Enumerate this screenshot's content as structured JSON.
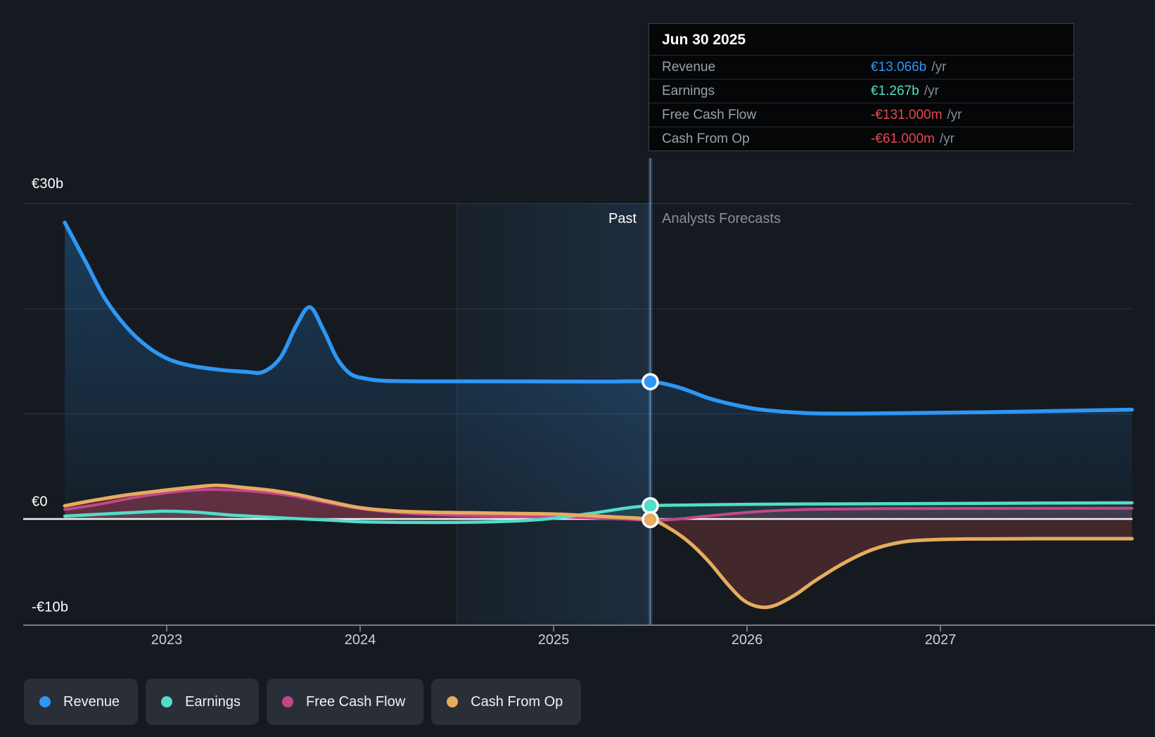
{
  "tooltip": {
    "date": "Jun 30 2025",
    "rows": [
      {
        "label": "Revenue",
        "value": "€13.066b",
        "suffix": "/yr",
        "color": "#2e96f5"
      },
      {
        "label": "Earnings",
        "value": "€1.267b",
        "suffix": "/yr",
        "color": "#53dcc9"
      },
      {
        "label": "Free Cash Flow",
        "value": "-€131.000m",
        "suffix": "/yr",
        "color": "#e5484d"
      },
      {
        "label": "Cash From Op",
        "value": "-€61.000m",
        "suffix": "/yr",
        "color": "#e5484d"
      }
    ]
  },
  "chart": {
    "period_labels": {
      "past": "Past",
      "forecast": "Analysts Forecasts"
    },
    "y_axis_labels": [
      "€30b",
      "€0",
      "-€10b"
    ],
    "x_axis_labels": [
      "2023",
      "2024",
      "2025",
      "2026",
      "2027"
    ]
  },
  "legend": {
    "items": [
      {
        "label": "Revenue",
        "color": "#2e96f5"
      },
      {
        "label": "Earnings",
        "color": "#53dcc9"
      },
      {
        "label": "Free Cash Flow",
        "color": "#c4468a"
      },
      {
        "label": "Cash From Op",
        "color": "#e6ac5f"
      }
    ]
  },
  "chart_data": {
    "type": "area",
    "title": "Revenue, earnings and cash flow history and forecast",
    "x_unit": "year",
    "y_unit": "EUR billions",
    "xlim": [
      2022.47,
      2028.0
    ],
    "ylim": [
      -10,
      30
    ],
    "grid": true,
    "gridline_values": [
      30,
      20,
      10
    ],
    "zero_line": 0,
    "divider_x": 2025.5,
    "divider_date": "Jun 30 2025",
    "highlight_band": [
      2024.5,
      2025.5
    ],
    "legend_position": "bottom-left",
    "series": [
      {
        "name": "Revenue",
        "color": "#2e96f5",
        "points": [
          [
            2022.473,
            28.2
          ],
          [
            2022.58,
            24.5
          ],
          [
            2022.68,
            21.0
          ],
          [
            2022.79,
            18.3
          ],
          [
            2022.9,
            16.4
          ],
          [
            2023.01,
            15.2
          ],
          [
            2023.12,
            14.6
          ],
          [
            2023.27,
            14.2
          ],
          [
            2023.41,
            14.0
          ],
          [
            2023.5,
            14.0
          ],
          [
            2023.59,
            15.4
          ],
          [
            2023.67,
            18.4
          ],
          [
            2023.74,
            20.15
          ],
          [
            2023.81,
            18.0
          ],
          [
            2023.88,
            15.3
          ],
          [
            2023.95,
            13.8
          ],
          [
            2024.03,
            13.35
          ],
          [
            2024.12,
            13.15
          ],
          [
            2024.3,
            13.1
          ],
          [
            2024.6,
            13.1
          ],
          [
            2025.0,
            13.08
          ],
          [
            2025.3,
            13.07
          ],
          [
            2025.5,
            13.066
          ],
          [
            2025.65,
            12.5
          ],
          [
            2025.8,
            11.5
          ],
          [
            2025.95,
            10.8
          ],
          [
            2026.1,
            10.35
          ],
          [
            2026.35,
            10.05
          ],
          [
            2026.7,
            10.05
          ],
          [
            2027.2,
            10.15
          ],
          [
            2027.99,
            10.4
          ]
        ]
      },
      {
        "name": "Earnings",
        "color": "#53dcc9",
        "points": [
          [
            2022.473,
            0.27
          ],
          [
            2022.7,
            0.5
          ],
          [
            2022.9,
            0.68
          ],
          [
            2023.0,
            0.74
          ],
          [
            2023.15,
            0.65
          ],
          [
            2023.35,
            0.35
          ],
          [
            2023.6,
            0.1
          ],
          [
            2023.85,
            -0.12
          ],
          [
            2024.0,
            -0.27
          ],
          [
            2024.3,
            -0.33
          ],
          [
            2024.6,
            -0.3
          ],
          [
            2024.85,
            -0.15
          ],
          [
            2025.0,
            0.07
          ],
          [
            2025.2,
            0.55
          ],
          [
            2025.38,
            1.05
          ],
          [
            2025.5,
            1.267
          ],
          [
            2025.7,
            1.33
          ],
          [
            2026.0,
            1.4
          ],
          [
            2026.5,
            1.44
          ],
          [
            2027.0,
            1.47
          ],
          [
            2027.5,
            1.51
          ],
          [
            2027.99,
            1.54
          ]
        ]
      },
      {
        "name": "Free Cash Flow",
        "color": "#c4468a",
        "points": [
          [
            2022.473,
            0.9
          ],
          [
            2022.65,
            1.4
          ],
          [
            2022.85,
            2.1
          ],
          [
            2023.05,
            2.6
          ],
          [
            2023.2,
            2.8
          ],
          [
            2023.35,
            2.75
          ],
          [
            2023.5,
            2.55
          ],
          [
            2023.65,
            2.2
          ],
          [
            2023.8,
            1.65
          ],
          [
            2024.0,
            1.0
          ],
          [
            2024.2,
            0.6
          ],
          [
            2024.45,
            0.38
          ],
          [
            2024.7,
            0.26
          ],
          [
            2025.0,
            0.2
          ],
          [
            2025.2,
            0.1
          ],
          [
            2025.38,
            -0.02
          ],
          [
            2025.5,
            -0.131
          ],
          [
            2025.62,
            -0.04
          ],
          [
            2025.78,
            0.25
          ],
          [
            2025.92,
            0.5
          ],
          [
            2026.1,
            0.75
          ],
          [
            2026.35,
            0.92
          ],
          [
            2026.7,
            0.98
          ],
          [
            2027.2,
            1.0
          ],
          [
            2027.99,
            1.02
          ]
        ]
      },
      {
        "name": "Cash From Op",
        "color": "#e6ac5f",
        "points": [
          [
            2022.473,
            1.25
          ],
          [
            2022.6,
            1.7
          ],
          [
            2022.8,
            2.3
          ],
          [
            2023.0,
            2.75
          ],
          [
            2023.15,
            3.05
          ],
          [
            2023.27,
            3.2
          ],
          [
            2023.42,
            2.95
          ],
          [
            2023.55,
            2.7
          ],
          [
            2023.68,
            2.3
          ],
          [
            2023.83,
            1.7
          ],
          [
            2024.0,
            1.07
          ],
          [
            2024.2,
            0.74
          ],
          [
            2024.4,
            0.63
          ],
          [
            2024.6,
            0.58
          ],
          [
            2024.8,
            0.53
          ],
          [
            2025.0,
            0.47
          ],
          [
            2025.15,
            0.35
          ],
          [
            2025.32,
            0.18
          ],
          [
            2025.5,
            -0.061
          ],
          [
            2025.6,
            -0.9
          ],
          [
            2025.7,
            -2.2
          ],
          [
            2025.8,
            -4.0
          ],
          [
            2025.9,
            -6.2
          ],
          [
            2025.98,
            -7.7
          ],
          [
            2026.06,
            -8.35
          ],
          [
            2026.14,
            -8.25
          ],
          [
            2026.25,
            -7.2
          ],
          [
            2026.35,
            -5.9
          ],
          [
            2026.5,
            -4.2
          ],
          [
            2026.65,
            -2.9
          ],
          [
            2026.8,
            -2.2
          ],
          [
            2026.95,
            -1.98
          ],
          [
            2027.15,
            -1.9
          ],
          [
            2027.5,
            -1.87
          ],
          [
            2027.99,
            -1.87
          ]
        ]
      }
    ],
    "markers": [
      {
        "series": "Revenue",
        "x": 2025.5,
        "value": 13.066
      },
      {
        "series": "Earnings",
        "x": 2025.5,
        "value": 1.267
      },
      {
        "series": "Cash From Op",
        "x": 2025.5,
        "value": -0.061
      }
    ]
  }
}
